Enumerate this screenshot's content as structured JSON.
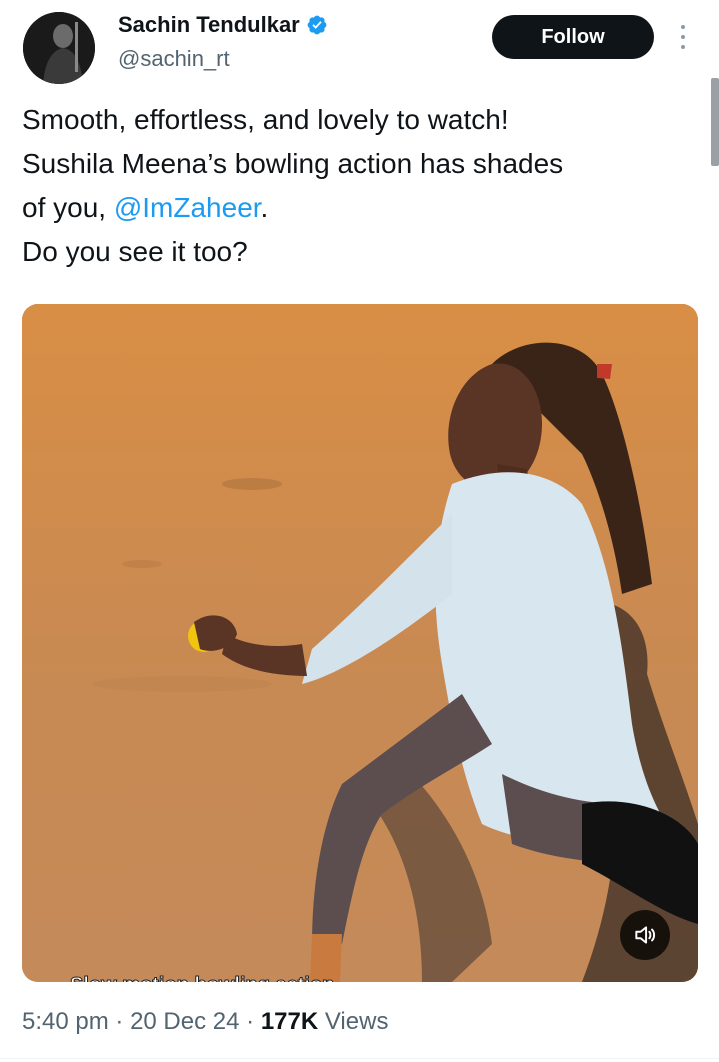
{
  "author": {
    "display_name": "Sachin Tendulkar",
    "handle": "@sachin_rt",
    "verified": true,
    "verified_color": "#1d9bf0"
  },
  "actions": {
    "follow_label": "Follow",
    "more_icon": "more-vertical-icon"
  },
  "tweet": {
    "line1": "Smooth, effortless, and lovely to watch!",
    "line2": "Sushila Meena’s bowling action has shades",
    "line3_prefix": "of you, ",
    "mention": "@ImZaheer",
    "line3_suffix": ".",
    "line4": "Do you see it too?",
    "mention_color": "#1d9bf0"
  },
  "media": {
    "type": "video",
    "caption": "Slow motion bowling action",
    "mute_icon": "speaker-muted-icon"
  },
  "meta": {
    "time": "5:40 pm",
    "separator": "·",
    "date": "20 Dec 24",
    "views_count": "177K",
    "views_label": "Views"
  }
}
